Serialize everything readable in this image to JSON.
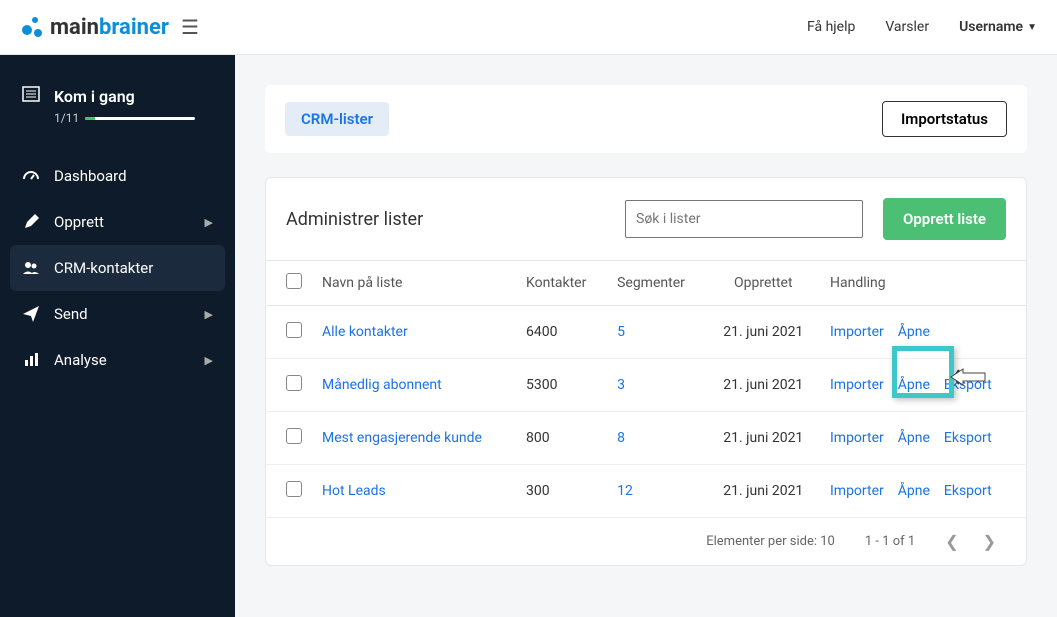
{
  "brand": {
    "part1": "main",
    "part2": "brainer"
  },
  "topbar": {
    "help": "Få hjelp",
    "alerts": "Varsler",
    "username": "Username"
  },
  "sidebar": {
    "kom": {
      "title": "Kom i gang",
      "progress": "1/11"
    },
    "items": [
      {
        "label": "Dashboard"
      },
      {
        "label": "Opprett"
      },
      {
        "label": "CRM-kontakter"
      },
      {
        "label": "Send"
      },
      {
        "label": "Analyse"
      }
    ]
  },
  "header_card": {
    "tab": "CRM-lister",
    "import_status": "Importstatus"
  },
  "list": {
    "title": "Administrer lister",
    "search_placeholder": "Søk i lister",
    "create": "Opprett liste",
    "columns": {
      "name": "Navn på liste",
      "contacts": "Kontakter",
      "segments": "Segmenter",
      "created": "Opprettet",
      "actions": "Handling"
    },
    "rows": [
      {
        "name": "Alle kontakter",
        "contacts": "6400",
        "segments": "5",
        "created": "21. juni 2021",
        "a1": "Importer",
        "a2": "Åpne",
        "a3": ""
      },
      {
        "name": "Månedlig abonnent",
        "contacts": "5300",
        "segments": "3",
        "created": "21. juni 2021",
        "a1": "Importer",
        "a2": "Åpne",
        "a3": "Eksport"
      },
      {
        "name": "Mest engasjerende kunde",
        "contacts": "800",
        "segments": "8",
        "created": "21. juni 2021",
        "a1": "Importer",
        "a2": "Åpne",
        "a3": "Eksport"
      },
      {
        "name": "Hot Leads",
        "contacts": "300",
        "segments": "12",
        "created": "21. juni 2021",
        "a1": "Importer",
        "a2": "Åpne",
        "a3": "Eksport"
      }
    ],
    "pager": {
      "per_page": "Elementer per side: 10",
      "range": "1 - 1 of 1"
    }
  }
}
